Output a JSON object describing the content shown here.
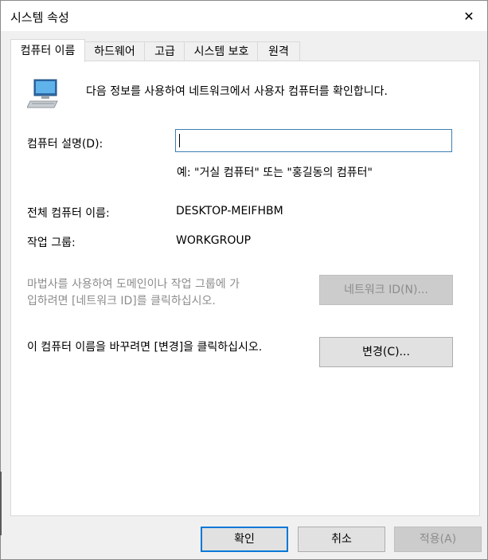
{
  "window": {
    "title": "시스템 속성",
    "close_symbol": "✕"
  },
  "tabs": [
    {
      "label": "컴퓨터 이름",
      "active": true
    },
    {
      "label": "하드웨어",
      "active": false
    },
    {
      "label": "고급",
      "active": false
    },
    {
      "label": "시스템 보호",
      "active": false
    },
    {
      "label": "원격",
      "active": false
    }
  ],
  "computer_name_tab": {
    "intro": "다음 정보를 사용하여 네트워크에서 사용자 컴퓨터를 확인합니다.",
    "description_label": "컴퓨터 설명(D):",
    "description_value": "",
    "description_example": "예: \"거실 컴퓨터\" 또는 \"홍길동의 컴퓨터\"",
    "full_name_label": "전체 컴퓨터 이름:",
    "full_name_value": "DESKTOP-MEIFHBM",
    "workgroup_label": "작업 그룹:",
    "workgroup_value": "WORKGROUP",
    "network_id_note_line1": "마법사를 사용하여 도메인이나 작업 그룹에 가",
    "network_id_note_line2": "입하려면 [네트워크 ID]를 클릭하십시오.",
    "network_id_button": "네트워크 ID(N)...",
    "rename_note": "이 컴퓨터 이름을 바꾸려면 [변경]을 클릭하십시오.",
    "change_button": "변경(C)..."
  },
  "footer": {
    "ok": "확인",
    "cancel": "취소",
    "apply": "적용(A)"
  },
  "colors": {
    "accent": "#0078d7",
    "disabled_text": "#8c8c8c"
  }
}
